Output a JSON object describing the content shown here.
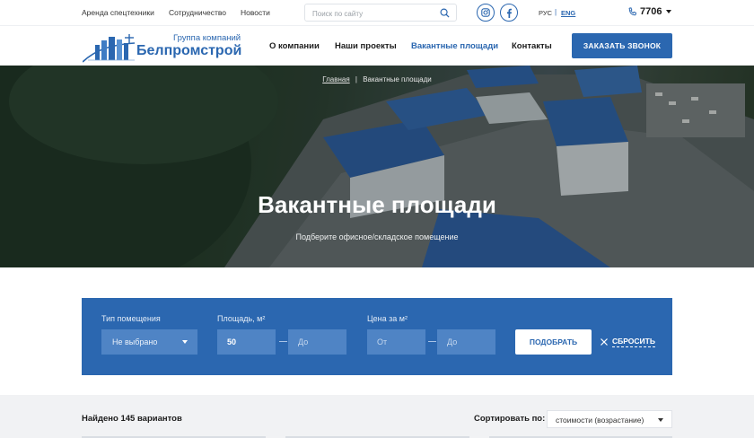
{
  "topbar": {
    "links": [
      "Аренда спецтехники",
      "Сотрудничество",
      "Новости"
    ],
    "search_placeholder": "Поиск по сайту",
    "lang_ru": "РУС",
    "lang_sep": "|",
    "lang_en": "ENG",
    "phone": "7706"
  },
  "logo": {
    "subtitle": "Группа компаний",
    "title": "Белпромстрой"
  },
  "nav": {
    "items": [
      "О компании",
      "Наши проекты",
      "Вакантные площади",
      "Контакты"
    ],
    "active_index": 2,
    "call_button": "ЗАКАЗАТЬ ЗВОНОК"
  },
  "hero": {
    "breadcrumb_home": "Главная",
    "breadcrumb_sep": "|",
    "breadcrumb_current": "Вакантные площади",
    "title": "Вакантные площади",
    "subtitle": "Подберите офисное/складское помещение"
  },
  "filter": {
    "type_label": "Тип помещения",
    "type_value": "Не выбрано",
    "area_label": "Площадь, м²",
    "area_from": "50",
    "area_to_placeholder": "До",
    "price_label": "Цена за м²",
    "price_from_placeholder": "От",
    "price_to_placeholder": "До",
    "apply_button": "ПОДОБРАТЬ",
    "reset_button": "СБРОСИТЬ"
  },
  "results": {
    "found_text": "Найдено 145 вариантов",
    "sort_label": "Сортировать по:",
    "sort_value": "стоимости (возрастание)"
  },
  "colors": {
    "brand": "#2b67b0",
    "filter_field": "#4f84c5",
    "results_bg": "#f1f2f4"
  }
}
